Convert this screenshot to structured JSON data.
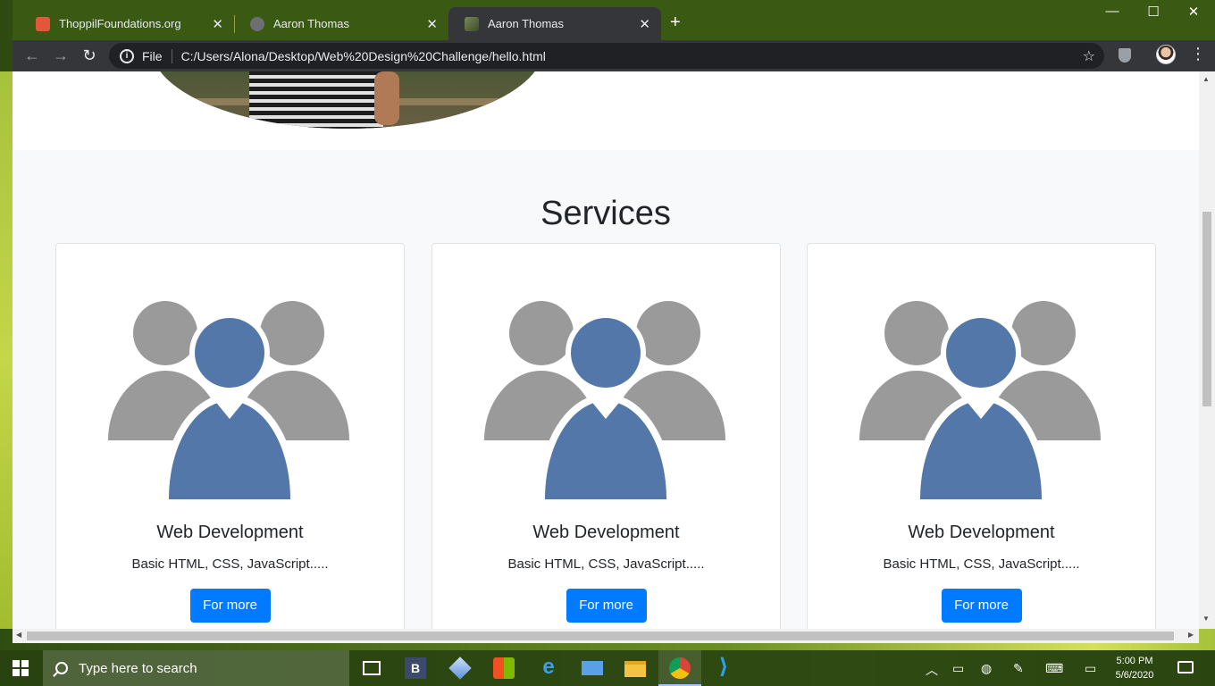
{
  "browser": {
    "tabs": [
      {
        "title": "ThoppilFoundations.org",
        "active": false
      },
      {
        "title": "Aaron Thomas",
        "active": false
      },
      {
        "title": "Aaron Thomas",
        "active": true
      }
    ],
    "new_tab_symbol": "+",
    "window_controls": {
      "minimize": "—",
      "maximize": "☐",
      "close": "✕"
    },
    "omnibox": {
      "scheme": "File",
      "url": "C:/Users/Alona/Desktop/Web%20Design%20Challenge/hello.html"
    },
    "icons": [
      "back-arrow-icon",
      "forward-arrow-icon",
      "reload-icon",
      "info-icon",
      "star-icon",
      "extension-shield-icon",
      "profile-avatar",
      "kebab-menu-icon"
    ]
  },
  "page": {
    "services": {
      "title": "Services",
      "cards": [
        {
          "title": "Web Development",
          "text": "Basic HTML, CSS, JavaScript.....",
          "button": "For more"
        },
        {
          "title": "Web Development",
          "text": "Basic HTML, CSS, JavaScript.....",
          "button": "For more"
        },
        {
          "title": "Web Development",
          "text": "Basic HTML, CSS, JavaScript.....",
          "button": "For more"
        }
      ]
    },
    "colors": {
      "primary_button": "#007bff",
      "section_bg": "#f8f9fa",
      "icon_blue": "#5277a8",
      "icon_gray": "#9a9a9a"
    }
  },
  "taskbar": {
    "search_placeholder": "Type here to search",
    "clock": {
      "time": "5:00 PM",
      "date": "5/6/2020"
    },
    "apps": [
      "task-view-icon",
      "bold-app-icon",
      "3d-box-icon",
      "store-icon",
      "edge-icon",
      "mail-icon",
      "file-explorer-icon",
      "chrome-icon",
      "vscode-icon"
    ]
  }
}
